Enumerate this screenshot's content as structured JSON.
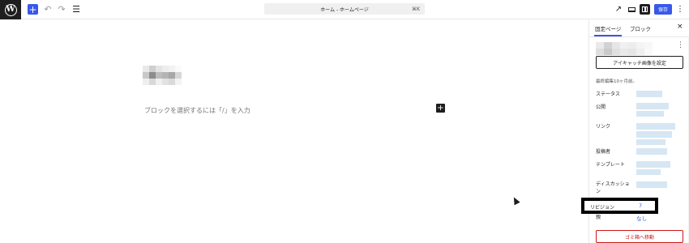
{
  "toolbar": {
    "logo_letter": "W",
    "add_icon": "+",
    "undo_icon": "↶",
    "redo_icon": "↷",
    "list_view_icon": "☰",
    "document_title": "ホーム - ホームページ",
    "shortcut": "⌘K",
    "external_icon": "↗",
    "save_label": "保存",
    "more_icon": "⋮"
  },
  "editor": {
    "placeholder": "ブロックを選択するには「/」を入力",
    "inserter_icon": "+"
  },
  "sidebar": {
    "tabs": [
      {
        "label": "固定ページ",
        "active": true
      },
      {
        "label": "ブロック",
        "active": false
      }
    ],
    "close_icon": "×",
    "kebab_icon": "⋮",
    "featured_image_button": "アイキャッチ画像を設定",
    "last_edited": "最終編集10ヶ月前。",
    "rows": {
      "status": "ステータス",
      "publish": "公開",
      "link": "リンク",
      "author": "投稿者",
      "template": "テンプレート",
      "discussion_line1": "ディスカッショ",
      "discussion_line2": "ン",
      "revisions": "リビジョン",
      "revisions_value": "7",
      "parent": "親",
      "parent_value": "なし"
    },
    "trash_button": "ゴミ箱へ移動"
  },
  "colors": {
    "accent": "#3858e9",
    "danger": "#cc1818",
    "dark": "#1e1e1e",
    "blurred_value": "#d6e6f3"
  }
}
